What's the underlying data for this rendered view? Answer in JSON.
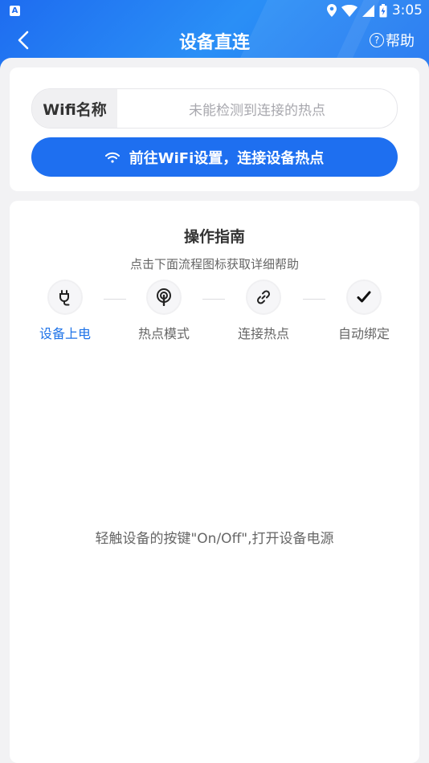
{
  "status_bar": {
    "app_icon_letter": "A",
    "time": "3:05",
    "icons": [
      "location-icon",
      "wifi-signal-icon",
      "cell-signal-icon",
      "battery-charging-icon"
    ]
  },
  "navbar": {
    "back_icon": "chevron-left-icon",
    "title": "设备直连",
    "help_symbol": "?",
    "help_label": "帮助"
  },
  "wifi_section": {
    "name_label": "Wifi名称",
    "name_value": "未能检测到连接的热点",
    "goto_button_label": "前往WiFi设置，连接设备热点",
    "goto_button_icon": "wifi-icon"
  },
  "guide": {
    "title": "操作指南",
    "subtitle": "点击下面流程图标获取详细帮助",
    "steps": [
      {
        "label": "设备上电",
        "icon": "power-plug-icon",
        "active": true
      },
      {
        "label": "热点模式",
        "icon": "hotspot-icon",
        "active": false
      },
      {
        "label": "连接热点",
        "icon": "link-icon",
        "active": false
      },
      {
        "label": "自动绑定",
        "icon": "checkmark-icon",
        "active": false
      }
    ],
    "instruction": "轻触设备的按键\"On/Off\",打开设备电源"
  },
  "colors": {
    "primary": "#1e6ff0",
    "active_step_text": "#1e73e8",
    "text_muted": "#666666"
  }
}
